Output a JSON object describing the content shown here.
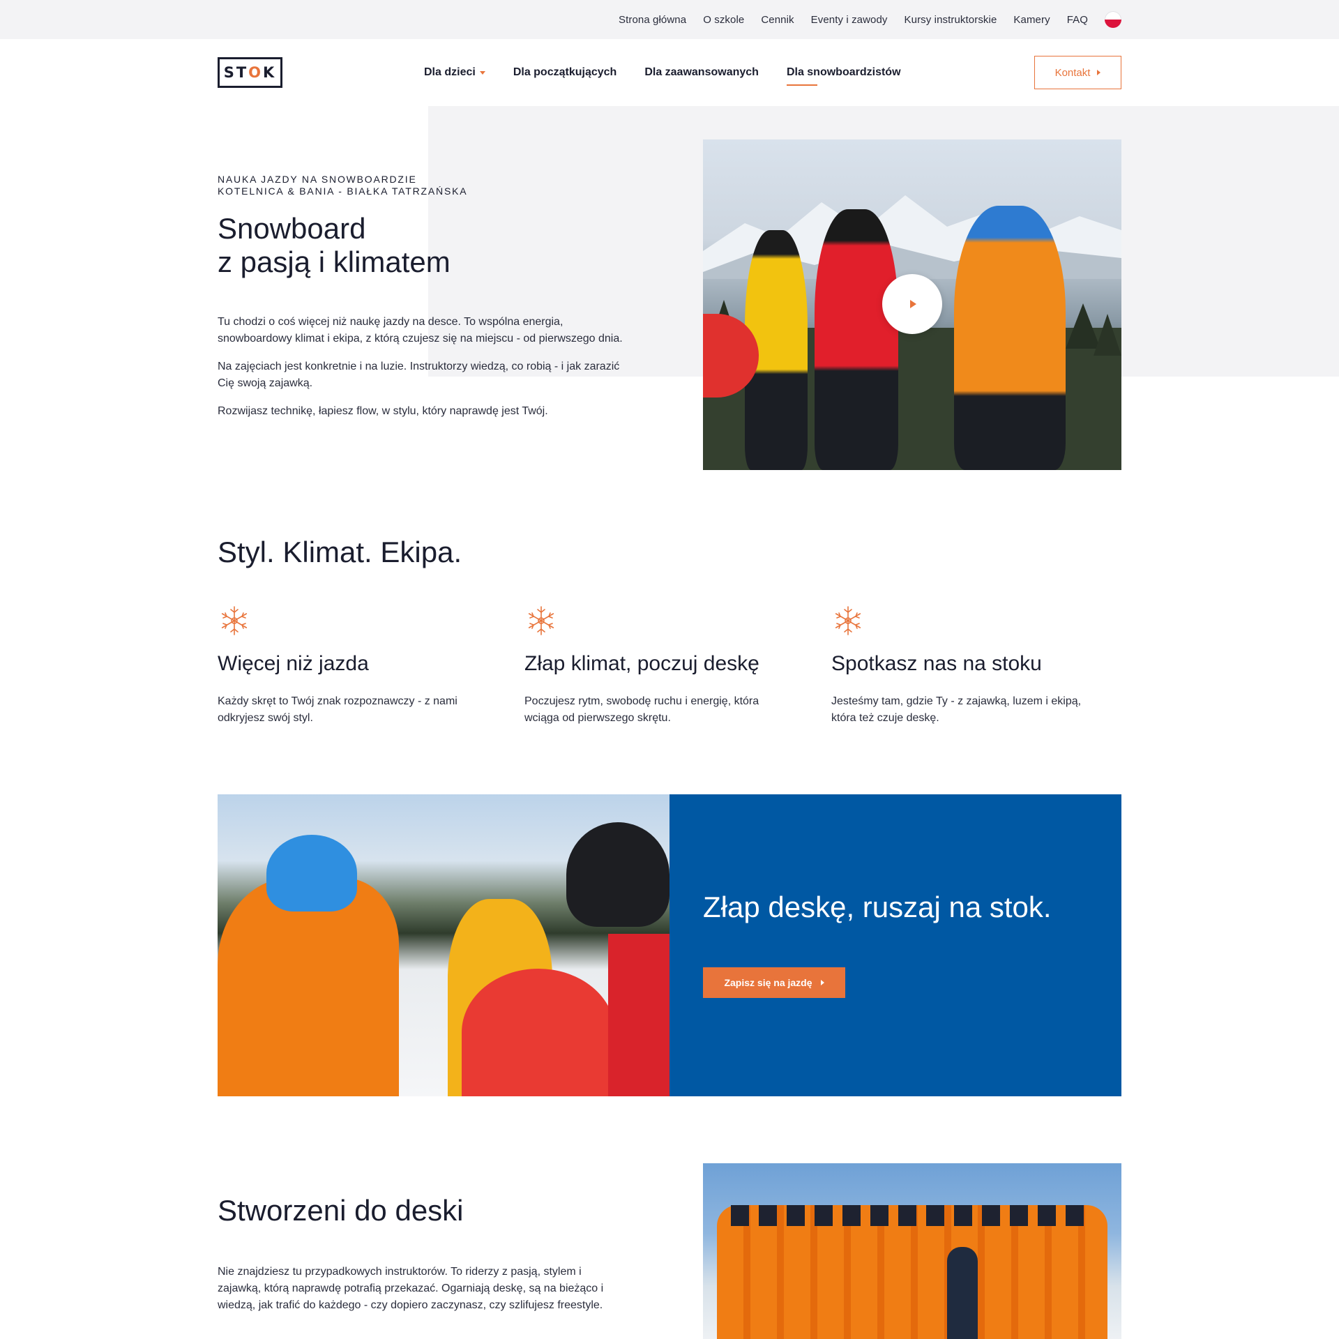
{
  "topnav": {
    "items": [
      "Strona główna",
      "O szkole",
      "Cennik",
      "Eventy i zawody",
      "Kursy instruktorskie",
      "Kamery",
      "FAQ"
    ]
  },
  "logo": {
    "left": "ST",
    "mid": "O",
    "right": "K"
  },
  "mainnav": {
    "items": [
      "Dla dzieci",
      "Dla początkujących",
      "Dla zaawansowanych",
      "Dla snowboardzistów"
    ],
    "contact": "Kontakt"
  },
  "hero": {
    "eyebrow_line1": "NAUKA JAZDY NA SNOWBOARDZIE",
    "eyebrow_line2": "KOTELNICA & BANIA - BIAŁKA TATRZAŃSKA",
    "title_line1": "Snowboard",
    "title_line2": "z pasją i klimatem",
    "paragraphs": [
      "Tu chodzi o coś więcej niż naukę jazdy na desce. To wspólna energia, snowboardowy klimat i ekipa, z którą czujesz się na miejscu - od pierwszego dnia.",
      "Na zajęciach jest konkretnie i na luzie. Instruktorzy wiedzą, co robią - i jak zarazić Cię swoją zajawką.",
      "Rozwijasz technikę, łapiesz flow, w stylu, który naprawdę jest Twój."
    ]
  },
  "features": {
    "title": "Styl. Klimat. Ekipa.",
    "items": [
      {
        "icon": "snowflake-icon",
        "title": "Więcej niż jazda",
        "text": "Każdy skręt to Twój znak rozpoznawczy - z nami odkryjesz swój styl."
      },
      {
        "icon": "snowflake-icon",
        "title": "Złap klimat, poczuj deskę",
        "text": "Poczujesz rytm, swobodę ruchu i energię, która wciąga od pierwszego skrętu."
      },
      {
        "icon": "snowflake-icon",
        "title": "Spotkasz nas na stoku",
        "text": "Jesteśmy tam, gdzie Ty - z zajawką, luzem i ekipą, która też czuje deskę."
      }
    ]
  },
  "cta": {
    "title": "Złap deskę, ruszaj na stok.",
    "button": "Zapisz się na jazdę"
  },
  "team": {
    "title": "Stworzeni do deski",
    "text": "Nie znajdziesz tu przypadkowych instruktorów. To riderzy z pasją, stylem i zajawką, którą naprawdę potrafią przekazać. Ogarniają deskę, są na bieżąco i wiedzą, jak trafić do każdego - czy dopiero zaczynasz, czy szlifujesz freestyle."
  },
  "colors": {
    "accent": "#e8743b",
    "primary_blue": "#0058a3",
    "text": "#1a1d2e",
    "topbar_bg": "#f3f3f5"
  }
}
